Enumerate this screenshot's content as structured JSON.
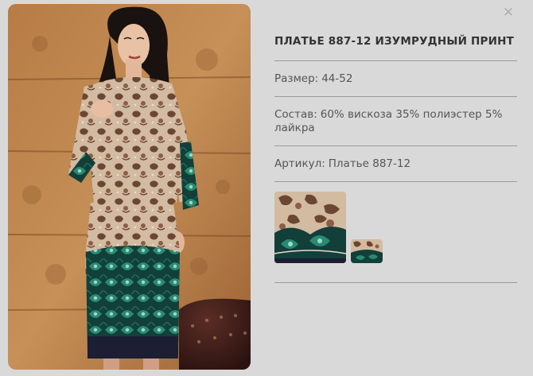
{
  "dialog": {
    "close_glyph": "×"
  },
  "product": {
    "title": "ПЛАТЬЕ 887-12 ИЗУМРУДНЫЙ ПРИНТ",
    "size_label": "Размер:",
    "size_value": "44-52",
    "composition_label": "Состав:",
    "composition_value": "60% вискоза 35% полиэстер 5% лайкра",
    "article_label": "Артикул:",
    "article_value": "Платье 887-12"
  },
  "thumbnails": [
    {
      "name": "fabric-print-large",
      "selected": true
    },
    {
      "name": "fabric-print-small",
      "selected": false
    }
  ],
  "colors": {
    "background": "#d9d9d9",
    "divider": "#9a9a9a",
    "wall": "#b97a44",
    "dress_beige": "#cfb59b",
    "dress_brown": "#6e4a35",
    "dress_emerald": "#1e6c5a",
    "dress_navy": "#1c1e33"
  }
}
